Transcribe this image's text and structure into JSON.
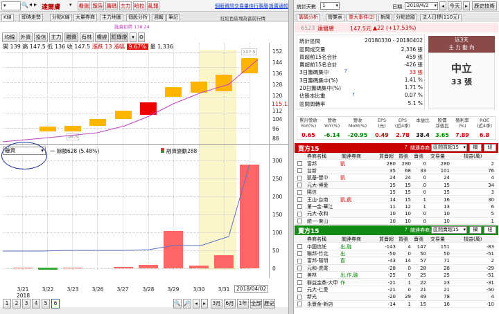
{
  "left_toolbar": {
    "code": "6523",
    "name": "達爾膚",
    "tabs": [
      "看盤",
      "報告",
      "籌碼",
      "主力",
      "哈拉",
      "亂報"
    ],
    "links": [
      "個股資訊",
      "交易量佳",
      "行事曆",
      "設置通知"
    ]
  },
  "subtabs": [
    "K線",
    "即時走勢",
    "分點K線",
    "大量券商",
    "主力地圖",
    "個股分析",
    "週報",
    "筆記"
  ],
  "subnote": "紅紅色區塊為當前行情",
  "legend_line": "融資扣帶 138.24",
  "indicators": [
    "均線",
    "外資",
    "投信",
    "主力",
    "融資",
    "有林",
    "權證",
    "紅綠燈"
  ],
  "price_line": {
    "open_label": "開",
    "open": "139",
    "high_label": "高",
    "high": "147.5",
    "low_label": "低",
    "low": "136",
    "close_label": "收",
    "close": "147.5",
    "limit_label": "漲跌",
    "limit": "13",
    "pct_label": "漲幅",
    "pct": "9.67%",
    "vol_label": "量",
    "vol": "1,336"
  },
  "price_axis": [
    "152",
    "144",
    "136",
    "128",
    "120",
    "112",
    "104",
    "96",
    "88"
  ],
  "price_current": "115.12",
  "price_low_marker": "94.5",
  "price_high_marker": "147.5",
  "lower_dropdown": "融資",
  "lower_legend_left": "一 餘額628 (5.48%)",
  "lower_legend_right": "融資變動288",
  "lower_axis": [
    "300",
    "250",
    "200",
    "150",
    "100",
    "50",
    "0"
  ],
  "dates": [
    "3/21",
    "3/22",
    "3/23",
    "3/26",
    "3/27",
    "3/28",
    "3/29",
    "3/30",
    "3/31",
    "2018/04/02"
  ],
  "year": "2018",
  "pager": [
    "1",
    "2",
    "3",
    "4",
    "5",
    "6"
  ],
  "range_buttons": [
    "3月",
    "6月",
    "1年",
    "全部",
    "歷史"
  ],
  "right_header": {
    "cols_label": "統計天數",
    "days": "1",
    "date_label": "日期:",
    "date": "2018/4/2",
    "today": "今天",
    "tool": "歷史技術"
  },
  "right_tabs": [
    "籌碼分析",
    "營業表",
    "重大事件(2)",
    "新聞",
    "分點追蹤",
    "法人日標(110元)"
  ],
  "quote": {
    "code": "6523",
    "name": "達爾膚",
    "price": "147.5元",
    "change": "▲22 (+17.53%)"
  },
  "stats": [
    {
      "label": "統計區間",
      "value": "20180330 - 20180402"
    },
    {
      "label": "區間成交量",
      "value": "2,336 張"
    },
    {
      "label": "買超前15名合計",
      "value": "459 張"
    },
    {
      "label": "賣超前15名合計",
      "value": "-426 張"
    },
    {
      "label": "3日籌碼集中",
      "value": "33 張"
    },
    {
      "label": "3日籌碼集中(%)",
      "value": "1.41 %"
    },
    {
      "label": "20日籌碼集中(%)",
      "value": "1.71 %"
    },
    {
      "label": "佔股本比重",
      "value": "0.07 %"
    },
    {
      "label": "區間周轉率",
      "value": "5.1 %"
    }
  ],
  "trend": {
    "head": "近3天\n主 力 動 向",
    "word": "中立",
    "value": "33 張"
  },
  "metrics": {
    "headers": [
      "累計營收\nYoY(%)",
      "營收\nYoY(%)",
      "營收\nMoM(%)",
      "EPS\n(元)",
      "EPS\n(近4季)",
      "本益比",
      "股價\n淨值比",
      "殖利率\n(%)",
      "ROE\n(近4季)"
    ],
    "values": [
      "0.65",
      "-6.14",
      "-20.95",
      "0.49",
      "2.78",
      "38.4",
      "3.65",
      "7.89",
      "6.8"
    ]
  },
  "buy": {
    "title": "買方15",
    "select_label": "關連券商:",
    "select": "區間買超15",
    "btn1": "欄",
    "btn2": "紐",
    "cols": [
      "券商名稱",
      "關連券商",
      "買賣超",
      "買張",
      "賣張",
      "交易量",
      "損益(萬)"
    ],
    "rows": [
      [
        "富邦",
        "凱",
        "280",
        "280",
        "0",
        "280",
        "2"
      ],
      [
        "台新",
        "",
        "35",
        "68",
        "33",
        "101",
        "76"
      ],
      [
        "凱基-豐中",
        "凱",
        "24",
        "24",
        "0",
        "24",
        "4"
      ],
      [
        "元大-博愛",
        "",
        "15",
        "15",
        "0",
        "15",
        "34"
      ],
      [
        "陽信",
        "",
        "15",
        "15",
        "0",
        "15",
        "3"
      ],
      [
        "王山-台南",
        "凱,凱",
        "14",
        "15",
        "1",
        "16",
        "30"
      ],
      [
        "第一金-華江",
        "",
        "11",
        "12",
        "1",
        "13",
        "6"
      ],
      [
        "元大-永和",
        "",
        "10",
        "10",
        "0",
        "10",
        "5"
      ],
      [
        "統一-東山",
        "",
        "10",
        "10",
        "0",
        "10",
        "1"
      ]
    ]
  },
  "sell": {
    "title": "賣方15",
    "select_label": "關連券商:",
    "select": "區間賣超15",
    "btn1": "欄",
    "btn2": "紐",
    "cols": [
      "券商名稱",
      "關連券商",
      "買賣超",
      "買張",
      "賣張",
      "交易量",
      "損益(萬)"
    ],
    "rows": [
      [
        "中國信託",
        "出,融",
        "-143",
        "4",
        "147",
        "151",
        "-83"
      ],
      [
        "聯邦-竹北",
        "出",
        "-50",
        "0",
        "50",
        "50",
        "-51"
      ],
      [
        "富邦-陽明",
        "直",
        "-43",
        "14",
        "57",
        "71",
        "2"
      ],
      [
        "元和-虎尾",
        "",
        "-28",
        "0",
        "28",
        "28",
        "-29"
      ],
      [
        "美林",
        "出,作,融",
        "-25",
        "0",
        "25",
        "25",
        "-51"
      ],
      [
        "群益金鼎-大甲",
        "作",
        "-21",
        "1",
        "22",
        "23",
        "-31"
      ],
      [
        "元大-仁愛",
        "",
        "-21",
        "0",
        "21",
        "21",
        "-50"
      ],
      [
        "新光",
        "",
        "-20",
        "29",
        "49",
        "78",
        "4"
      ],
      [
        "永豐金-新店",
        "",
        "-14",
        "1",
        "15",
        "16",
        "-10"
      ]
    ]
  },
  "colors": {
    "up_bar": "#ffb400",
    "down_bar": "#ee0000",
    "ma": "#c040c0",
    "vol_bar": "#ff6666",
    "vol_line": "#5b6fc7",
    "highlight": "#fbf6c9",
    "buy_head": "#c80000",
    "sell_head": "#138a13"
  }
}
